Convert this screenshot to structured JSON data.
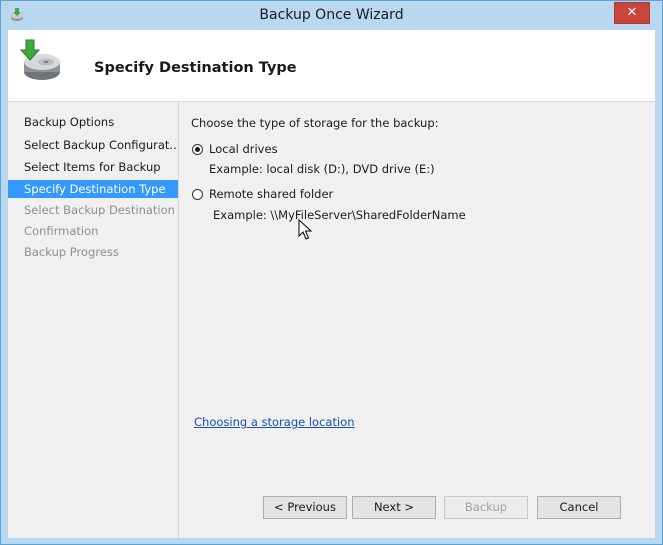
{
  "window": {
    "title": "Backup Once Wizard",
    "close_glyph": "✕"
  },
  "header": {
    "title": "Specify Destination Type",
    "icon": "backup-wizard-icon"
  },
  "nav": {
    "items": [
      {
        "label": "Backup Options",
        "state": "normal"
      },
      {
        "label": "Select Backup Configurat...",
        "state": "normal"
      },
      {
        "label": "Select Items for Backup",
        "state": "normal"
      },
      {
        "label": "Specify Destination Type",
        "state": "active"
      },
      {
        "label": "Select Backup Destination",
        "state": "disabled"
      },
      {
        "label": "Confirmation",
        "state": "disabled"
      },
      {
        "label": "Backup Progress",
        "state": "disabled"
      }
    ]
  },
  "main": {
    "prompt": "Choose the type of storage for the backup:",
    "options": [
      {
        "label": "Local drives",
        "example": "Example: local disk (D:), DVD drive (E:)",
        "selected": true
      },
      {
        "label": "Remote shared folder",
        "example": "Example: \\\\MyFileServer\\SharedFolderName",
        "selected": false
      }
    ],
    "help_link": "Choosing a storage location"
  },
  "buttons": {
    "previous": "< Previous",
    "next": "Next >",
    "backup": "Backup",
    "cancel": "Cancel"
  },
  "colors": {
    "selection": "#3399ff",
    "close": "#c7453a",
    "link": "#1a4fb5",
    "frame": "#b9d7ef"
  }
}
